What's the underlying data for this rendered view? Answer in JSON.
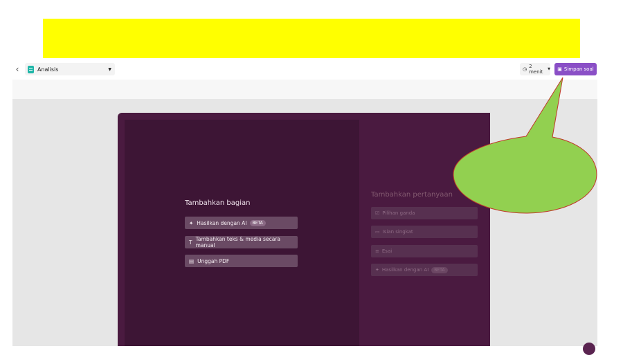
{
  "toolbar": {
    "doc_name": "Analisis",
    "timer": "2 menit",
    "save_label": "Simpan soal"
  },
  "left": {
    "title": "Tambahkan bagian",
    "options": [
      {
        "icon": "sparkle-icon",
        "label": "Hasilkan dengan AI",
        "badge": "BETA"
      },
      {
        "icon": "text-icon",
        "label": "Tambahkan teks & media secara manual"
      },
      {
        "icon": "file-icon",
        "label": "Unggah PDF"
      }
    ]
  },
  "right": {
    "title": "Tambahkan pertanyaan",
    "options": [
      {
        "icon": "checkbox-icon",
        "label": "Pilihan ganda"
      },
      {
        "icon": "short-answer-icon",
        "label": "Isian singkat"
      },
      {
        "icon": "essay-icon",
        "label": "Esai"
      },
      {
        "icon": "sparkle-icon",
        "label": "Hasilkan dengan AI",
        "badge": "BETA"
      }
    ]
  },
  "colors": {
    "banner": "#ffff00",
    "accent": "#8a4fc6",
    "callout": "#92d050",
    "callout_border": "#c0392b",
    "editor_bg": "#4a1a40"
  }
}
